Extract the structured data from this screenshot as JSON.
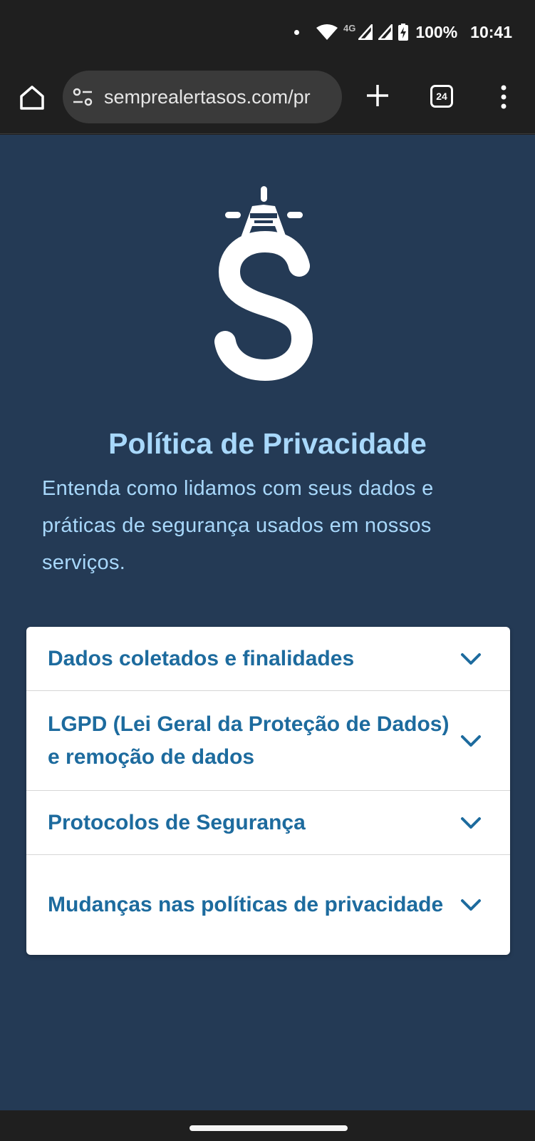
{
  "status_bar": {
    "network_type": "4G",
    "battery": "100%",
    "time": "10:41"
  },
  "browser": {
    "url": "semprealertasos.com/pr",
    "tab_count": "24",
    "icons": [
      "home-icon",
      "tune-icon",
      "plus-icon",
      "tabs-icon",
      "more-vert-icon"
    ]
  },
  "page": {
    "title": "Política de Privacidade",
    "subtitle": "Entenda como lidamos com seus dados e práticas de segurança usados em nossos serviços.",
    "accordion": [
      {
        "label": "Dados coletados e finalidades"
      },
      {
        "label": "LGPD (Lei Geral da Proteção de Dados) e remoção de dados"
      },
      {
        "label": "Protocolos de Segurança"
      },
      {
        "label": "Mudanças nas políticas de privacidade"
      }
    ]
  },
  "colors": {
    "page_background": "#243a55",
    "title_color": "#a8d8fb",
    "accordion_text": "#1d6b9e",
    "chrome_background": "#1f1f1f"
  }
}
